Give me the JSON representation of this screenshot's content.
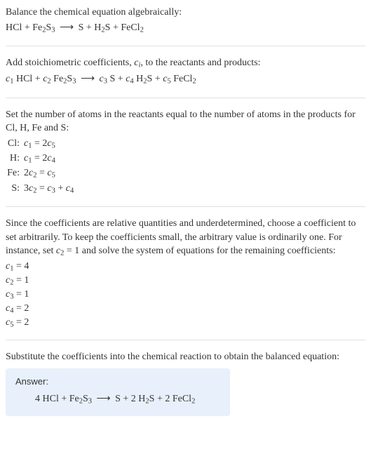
{
  "sec1": {
    "title": "Balance the chemical equation algebraically:",
    "eq_html": "HCl + Fe<sub>2</sub>S<sub>3</sub> <span class=\"arrow\">⟶</span> S + H<sub>2</sub>S + FeCl<sub>2</sub>"
  },
  "sec2": {
    "title_html": "Add stoichiometric coefficients, <i>c<sub>i</sub></i>, to the reactants and products:",
    "eq_html": "<i>c</i><sub>1</sub> HCl + <i>c</i><sub>2</sub> Fe<sub>2</sub>S<sub>3</sub> <span class=\"arrow\">⟶</span> <i>c</i><sub>3</sub> S + <i>c</i><sub>4</sub> H<sub>2</sub>S + <i>c</i><sub>5</sub> FeCl<sub>2</sub>"
  },
  "sec3": {
    "title": "Set the number of atoms in the reactants equal to the number of atoms in the products for Cl, H, Fe and S:",
    "rows": [
      {
        "elem": "Cl:",
        "eq_html": "<i>c</i><sub>1</sub> = 2<i>c</i><sub>5</sub>"
      },
      {
        "elem": "H:",
        "eq_html": "<i>c</i><sub>1</sub> = 2<i>c</i><sub>4</sub>"
      },
      {
        "elem": "Fe:",
        "eq_html": "2<i>c</i><sub>2</sub> = <i>c</i><sub>5</sub>"
      },
      {
        "elem": "S:",
        "eq_html": "3<i>c</i><sub>2</sub> = <i>c</i><sub>3</sub> + <i>c</i><sub>4</sub>"
      }
    ]
  },
  "sec4": {
    "title_html": "Since the coefficients are relative quantities and underdetermined, choose a coefficient to set arbitrarily. To keep the coefficients small, the arbitrary value is ordinarily one. For instance, set <i>c</i><sub>2</sub> = 1 and solve the system of equations for the remaining coefficients:",
    "coeffs": [
      {
        "html": "<i>c</i><sub>1</sub> = 4"
      },
      {
        "html": "<i>c</i><sub>2</sub> = 1"
      },
      {
        "html": "<i>c</i><sub>3</sub> = 1"
      },
      {
        "html": "<i>c</i><sub>4</sub> = 2"
      },
      {
        "html": "<i>c</i><sub>5</sub> = 2"
      }
    ]
  },
  "sec5": {
    "title": "Substitute the coefficients into the chemical reaction to obtain the balanced equation:",
    "answer_label": "Answer:",
    "answer_eq_html": "4 HCl + Fe<sub>2</sub>S<sub>3</sub> <span class=\"arrow\">⟶</span> S + 2 H<sub>2</sub>S + 2 FeCl<sub>2</sub>"
  },
  "chart_data": {
    "type": "table",
    "title": "Balance HCl + Fe2S3 → S + H2S + FeCl2",
    "atom_balance": [
      {
        "element": "Cl",
        "equation": "c1 = 2 c5"
      },
      {
        "element": "H",
        "equation": "c1 = 2 c4"
      },
      {
        "element": "Fe",
        "equation": "2 c2 = c5"
      },
      {
        "element": "S",
        "equation": "3 c2 = c3 + c4"
      }
    ],
    "solution": {
      "c1": 4,
      "c2": 1,
      "c3": 1,
      "c4": 2,
      "c5": 2
    },
    "balanced_equation": "4 HCl + Fe2S3 → S + 2 H2S + 2 FeCl2"
  }
}
